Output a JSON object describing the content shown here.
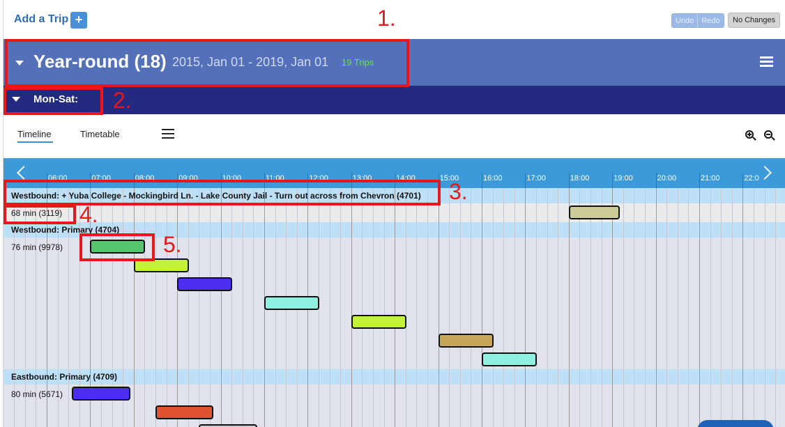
{
  "toolbar": {
    "add_trip_label": "Add a Trip",
    "add_icon": "+",
    "undo_label": "Undo",
    "redo_label": "Redo",
    "no_changes_label": "No Changes"
  },
  "calendar_header": {
    "title": "Year-round (18)",
    "date_range": "2015, Jan 01 - 2019, Jan 01",
    "trip_count": "19 Trips"
  },
  "service_header": {
    "title": "Mon-Sat:"
  },
  "tabs": {
    "timeline": "Timeline",
    "timetable": "Timetable"
  },
  "axis": {
    "hours": [
      "06:00",
      "07:00",
      "08:00",
      "09:00",
      "10:00",
      "11:00",
      "12:00",
      "13:00",
      "14:00",
      "15:00",
      "16:00",
      "17:00",
      "18:00",
      "19:00",
      "20:00",
      "21:00",
      "22:0"
    ]
  },
  "patterns": [
    {
      "name": "Westbound: + Yuba College - Mockingbird Ln. - Lake County Jail - Turn out across from Chevron (4701)",
      "trips": [
        {
          "label": "68 min (3119)",
          "start": "18:00",
          "end": "19:10",
          "color": "#cccc99"
        }
      ]
    },
    {
      "name": "Westbound: Primary (4704)",
      "trips": [
        {
          "label": "76 min (9978)",
          "start": "07:00",
          "end": "08:16",
          "color": "#55c56d"
        },
        {
          "label": "",
          "start": "08:00",
          "end": "09:16",
          "color": "#c3f03a"
        },
        {
          "label": "",
          "start": "09:00",
          "end": "10:16",
          "color": "#4b2ef0"
        },
        {
          "label": "",
          "start": "11:00",
          "end": "12:16",
          "color": "#8ef0df"
        },
        {
          "label": "",
          "start": "13:00",
          "end": "14:16",
          "color": "#c3f03a"
        },
        {
          "label": "",
          "start": "15:00",
          "end": "16:16",
          "color": "#c8a659"
        },
        {
          "label": "",
          "start": "16:00",
          "end": "17:16",
          "color": "#8ef0df"
        }
      ]
    },
    {
      "name": "Eastbound: Primary (4709)",
      "trips": [
        {
          "label": "80 min (5671)",
          "start": "06:35",
          "end": "07:55",
          "color": "#4b2ef0"
        },
        {
          "label": "",
          "start": "08:30",
          "end": "09:50",
          "color": "#e0522f"
        },
        {
          "label": "",
          "start": "09:30",
          "end": "10:50",
          "color": "#cccccc"
        }
      ]
    }
  ],
  "annotations": [
    "1.",
    "2.",
    "3.",
    "4.",
    "5."
  ],
  "colors": {
    "calendar_bar": "#5470b8",
    "service_bar": "#242a80",
    "axis_bar": "#3d9ad8",
    "pattern_row": "#bde0f6",
    "annotation": "#e8171b",
    "trip_count": "#6ce05a"
  }
}
